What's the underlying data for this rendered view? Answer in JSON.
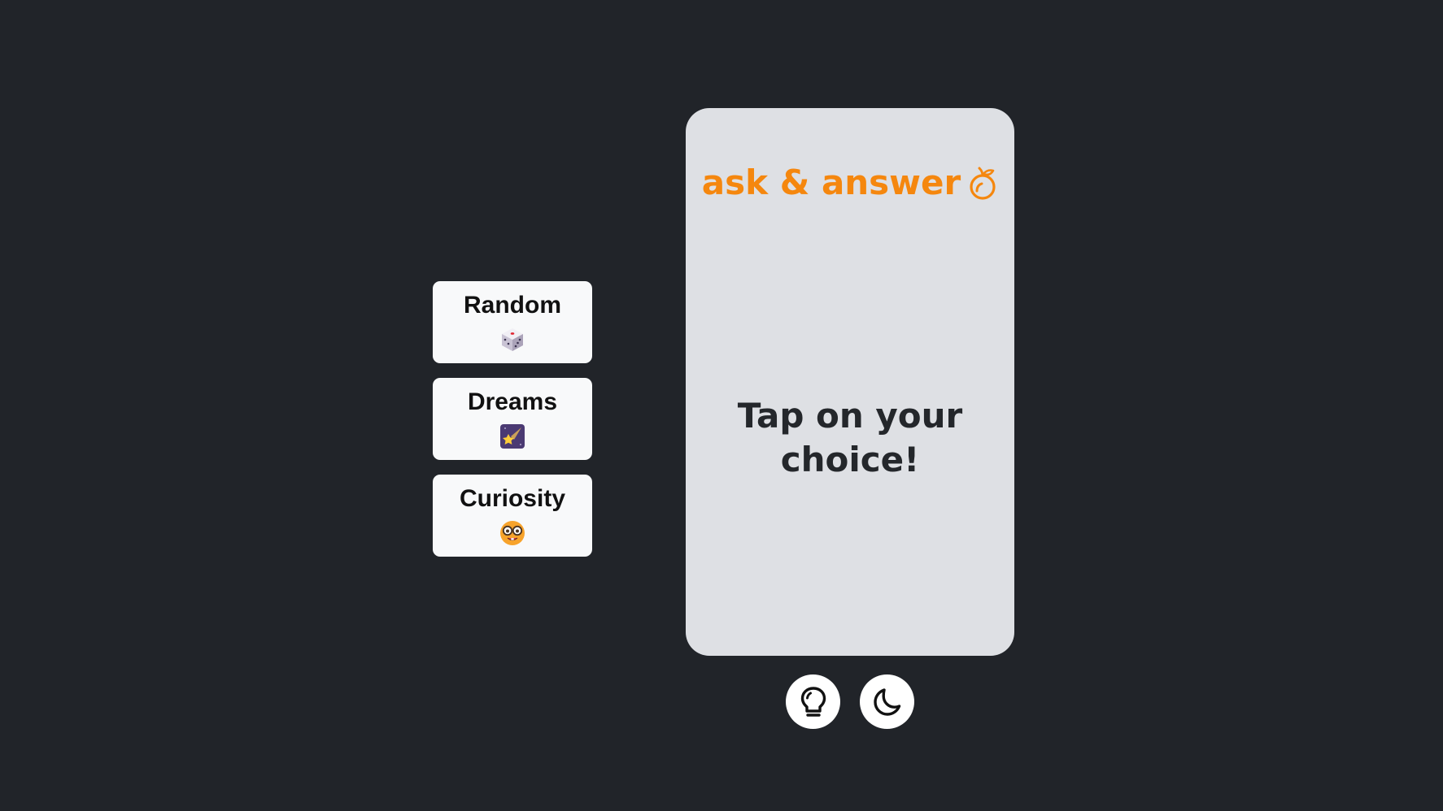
{
  "app": {
    "brand_title": "ask & answer",
    "brand_icon": "peach-outline-icon",
    "accent_color": "#f5870e",
    "background_color": "#212429",
    "card_color": "#dee0e4"
  },
  "categories": [
    {
      "label": "Random",
      "icon": "dice-emoji"
    },
    {
      "label": "Dreams",
      "icon": "shooting-star-emoji"
    },
    {
      "label": "Curiosity",
      "icon": "nerd-face-emoji"
    }
  ],
  "card": {
    "prompt": "Tap on your choice!"
  },
  "controls": {
    "hint_icon": "lightbulb-icon",
    "theme_icon": "moon-icon"
  }
}
